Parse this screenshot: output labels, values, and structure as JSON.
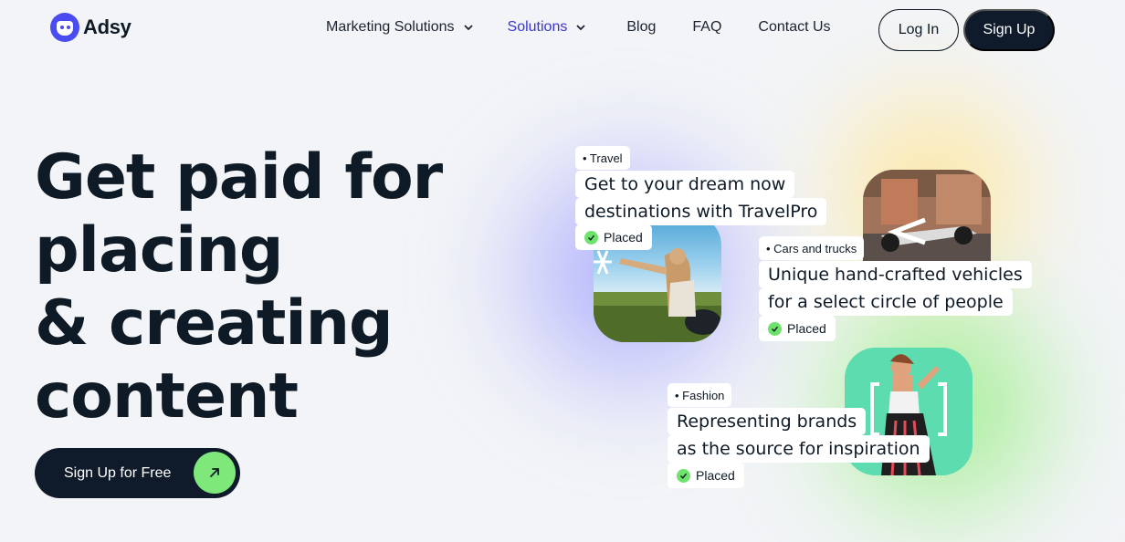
{
  "brand": {
    "name": "Adsy",
    "accent": "#4b4bf2"
  },
  "nav": {
    "items": [
      {
        "label": "Marketing Solutions",
        "dropdown": true,
        "active": false
      },
      {
        "label": "Solutions",
        "dropdown": true,
        "active": true
      },
      {
        "label": "Blog",
        "dropdown": false,
        "active": false
      },
      {
        "label": "FAQ",
        "dropdown": false,
        "active": false
      },
      {
        "label": "Contact Us",
        "dropdown": false,
        "active": false
      }
    ],
    "login_label": "Log In",
    "signup_label": "Sign Up"
  },
  "hero": {
    "title_bold": "Get paid",
    "title_rest_1": "for",
    "title_line_2": "placing",
    "title_line_3": "& creating",
    "title_line_4": "content",
    "cta_label": "Sign Up for Free"
  },
  "cards": [
    {
      "category": "• Travel",
      "line1": "Get to your dream now",
      "line2": "destinations with TravelPro",
      "status": "Placed"
    },
    {
      "category": "• Cars and trucks",
      "line1": "Unique hand-crafted vehicles",
      "line2": "for a select circle of people",
      "status": "Placed"
    },
    {
      "category": "• Fashion",
      "line1": "Representing brands",
      "line2": "as the source for inspiration",
      "status": "Placed"
    }
  ],
  "colors": {
    "dark": "#0f1b2b",
    "active_nav": "#3b33d6",
    "green": "#7ee97a",
    "background": "#f2f4f7"
  }
}
